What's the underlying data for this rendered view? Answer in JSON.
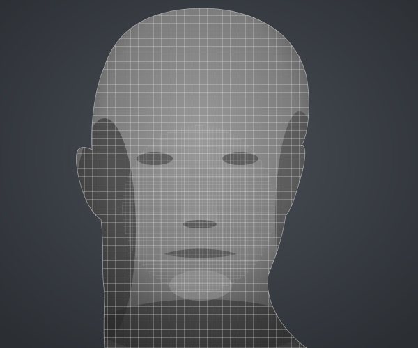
{
  "scene": {
    "subject": "wireframe-head-render",
    "colors": {
      "background_center": "#4a5058",
      "background_edge": "#2b2f34",
      "skin_light": "#9a9a9a",
      "skin_mid": "#7c7c7c",
      "skin_dark": "#3c3c3c",
      "wire": "#e8e8e8"
    }
  }
}
